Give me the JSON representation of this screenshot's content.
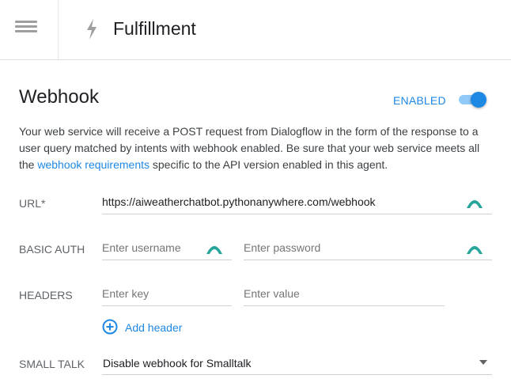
{
  "header": {
    "title": "Fulfillment",
    "menu_icon": "hamburger-menu-icon",
    "section_icon": "lightning-bolt-icon"
  },
  "webhook": {
    "title": "Webhook",
    "status_label": "ENABLED",
    "enabled": true,
    "description_before_link": "Your web service will receive a POST request from Dialogflow in the form of the response to a user query matched by intents with webhook enabled. Be sure that your web service meets all the ",
    "description_link": "webhook requirements",
    "description_after_link": " specific to the API version enabled in this agent.",
    "url": {
      "label": "URL*",
      "value": "https://aiweatherchatbot.pythonanywhere.com/webhook"
    },
    "basic_auth": {
      "label": "BASIC AUTH",
      "username_placeholder": "Enter username",
      "password_placeholder": "Enter password"
    },
    "headers": {
      "label": "HEADERS",
      "key_placeholder": "Enter key",
      "value_placeholder": "Enter value",
      "add_label": "Add header"
    },
    "small_talk": {
      "label": "SMALL TALK",
      "selected": "Disable webhook for Smalltalk"
    }
  },
  "colors": {
    "accent": "#1e88e5",
    "key_icon": "#26a69a",
    "text": "#202124"
  }
}
